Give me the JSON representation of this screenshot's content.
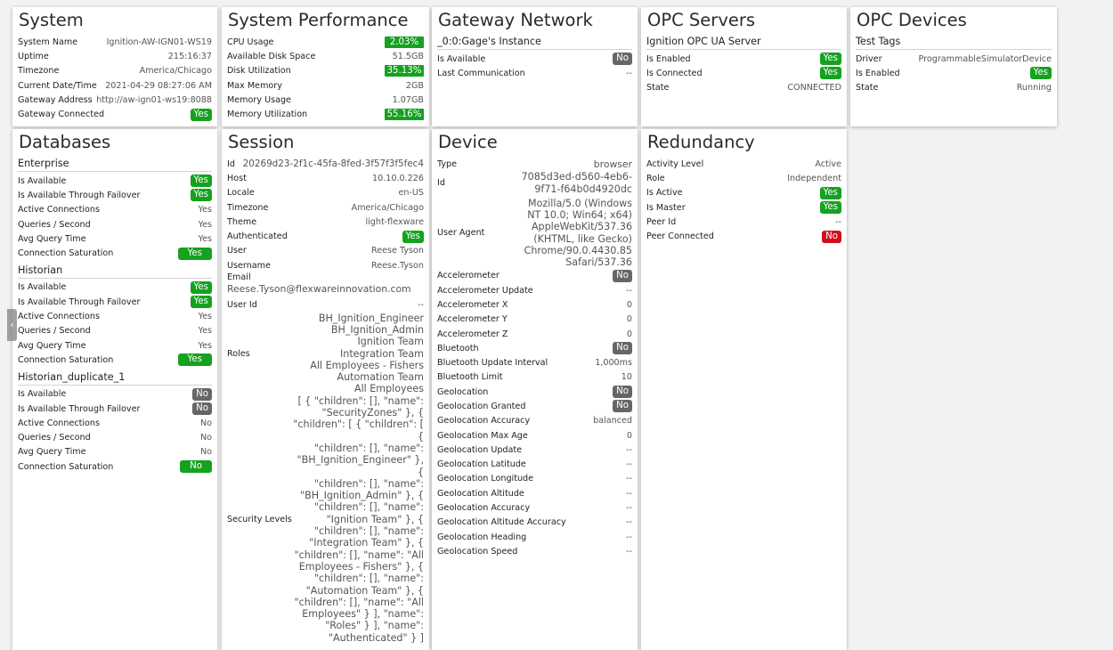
{
  "system": {
    "title": "System",
    "rows": [
      {
        "label": "System Name",
        "value": "Ignition-AW-IGN01-WS19"
      },
      {
        "label": "Uptime",
        "value": "215:16:37"
      },
      {
        "label": "Timezone",
        "value": "America/Chicago"
      },
      {
        "label": "Current Date/Time",
        "value": "2021-04-29 08:27:06 AM"
      },
      {
        "label": "Gateway Address",
        "value": "http://aw-ign01-ws19:8088"
      },
      {
        "label": "Gateway Connected",
        "value": "Yes"
      }
    ]
  },
  "performance": {
    "title": "System Performance",
    "rows": [
      {
        "label": "CPU Usage",
        "value": "2.03%"
      },
      {
        "label": "Available Disk Space",
        "value": "51.5GB"
      },
      {
        "label": "Disk Utilization",
        "value": "35.13%"
      },
      {
        "label": "Max Memory",
        "value": "2GB"
      },
      {
        "label": "Memory Usage",
        "value": "1.07GB"
      },
      {
        "label": "Memory Utilization",
        "value": "55.16%"
      }
    ]
  },
  "gateway_network": {
    "title": "Gateway Network",
    "instance": "_0:0:Gage's Instance",
    "rows": [
      {
        "label": "Is Available",
        "value": "No"
      },
      {
        "label": "Last Communication",
        "value": "--"
      }
    ]
  },
  "opc_servers": {
    "title": "OPC Servers",
    "server": "Ignition OPC UA Server",
    "rows": [
      {
        "label": "Is Enabled",
        "value": "Yes"
      },
      {
        "label": "Is Connected",
        "value": "Yes"
      },
      {
        "label": "State",
        "value": "CONNECTED"
      }
    ]
  },
  "opc_devices": {
    "title": "OPC Devices",
    "device": "Test Tags",
    "rows": [
      {
        "label": "Driver",
        "value": "ProgrammableSimulatorDevice"
      },
      {
        "label": "Is Enabled",
        "value": "Yes"
      },
      {
        "label": "State",
        "value": "Running"
      }
    ]
  },
  "databases": {
    "title": "Databases",
    "groups": [
      {
        "name": "Enterprise",
        "rows": [
          {
            "label": "Is Available",
            "value": "Yes"
          },
          {
            "label": "Is Available Through Failover",
            "value": "Yes"
          },
          {
            "label": "Active Connections",
            "value": "Yes"
          },
          {
            "label": "Queries / Second",
            "value": "Yes"
          },
          {
            "label": "Avg Query Time",
            "value": "Yes"
          },
          {
            "label": "Connection Saturation",
            "value": "Yes"
          }
        ]
      },
      {
        "name": "Historian",
        "rows": [
          {
            "label": "Is Available",
            "value": "Yes"
          },
          {
            "label": "Is Available Through Failover",
            "value": "Yes"
          },
          {
            "label": "Active Connections",
            "value": "Yes"
          },
          {
            "label": "Queries / Second",
            "value": "Yes"
          },
          {
            "label": "Avg Query Time",
            "value": "Yes"
          },
          {
            "label": "Connection Saturation",
            "value": "Yes"
          }
        ]
      },
      {
        "name": "Historian_duplicate_1",
        "rows": [
          {
            "label": "Is Available",
            "value": "No"
          },
          {
            "label": "Is Available Through Failover",
            "value": "No"
          },
          {
            "label": "Active Connections",
            "value": "No"
          },
          {
            "label": "Queries / Second",
            "value": "No"
          },
          {
            "label": "Avg Query Time",
            "value": "No"
          },
          {
            "label": "Connection Saturation",
            "value": "No"
          }
        ]
      }
    ]
  },
  "session": {
    "title": "Session",
    "id_label": "Id",
    "id_value": "20269d23-2f1c-45fa-8fed-3f57f3f5fec4",
    "rows": [
      {
        "label": "Host",
        "value": "10.10.0.226"
      },
      {
        "label": "Locale",
        "value": "en-US"
      },
      {
        "label": "Timezone",
        "value": "America/Chicago"
      },
      {
        "label": "Theme",
        "value": "light-flexware"
      },
      {
        "label": "Authenticated",
        "value": "Yes"
      },
      {
        "label": "User",
        "value": "Reese Tyson"
      },
      {
        "label": "Username",
        "value": "Reese.Tyson"
      }
    ],
    "email_label": "Email",
    "email_value": "Reese.Tyson@flexwareinnovation.com",
    "userid_label": "User Id",
    "userid_value": "--",
    "roles_label": "Roles",
    "roles": [
      "BH_Ignition_Engineer",
      "BH_Ignition_Admin",
      "Ignition Team",
      "Integration Team",
      "All Employees - Fishers",
      "Automation Team",
      "All Employees"
    ],
    "security_label": "Security Levels",
    "security_lines": [
      "[ { \"children\": [], \"name\":",
      "\"SecurityZones\" }, {",
      "\"children\": [ { \"children\": [ {",
      "\"children\": [], \"name\":",
      "\"BH_Ignition_Engineer\" }, {",
      "\"children\": [], \"name\":",
      "\"BH_Ignition_Admin\" }, {",
      "\"children\": [], \"name\":",
      "\"Ignition Team\" }, {",
      "\"children\": [], \"name\":",
      "\"Integration Team\" }, {",
      "\"children\": [], \"name\": \"All",
      "Employees - Fishers\" }, {",
      "\"children\": [], \"name\":",
      "\"Automation Team\" }, {",
      "\"children\": [], \"name\": \"All",
      "Employees\" } ], \"name\":",
      "\"Roles\" } ], \"name\":",
      "\"Authenticated\" } ]"
    ]
  },
  "device": {
    "title": "Device",
    "type_label": "Type",
    "type_value": "browser",
    "id_label": "Id",
    "id_lines": [
      "7085d3ed-d560-4eb6-",
      "9f71-f64b0d4920dc"
    ],
    "ua_label": "User Agent",
    "ua_lines": [
      "Mozilla/5.0 (Windows",
      "NT 10.0; Win64; x64)",
      "AppleWebKit/537.36",
      "(KHTML, like Gecko)",
      "Chrome/90.0.4430.85",
      "Safari/537.36"
    ],
    "rows": [
      {
        "label": "Accelerometer",
        "value": "No"
      },
      {
        "label": "Accelerometer Update",
        "value": "--"
      },
      {
        "label": "Accelerometer X",
        "value": "0"
      },
      {
        "label": "Accelerometer Y",
        "value": "0"
      },
      {
        "label": "Accelerometer Z",
        "value": "0"
      },
      {
        "label": "Bluetooth",
        "value": "No"
      },
      {
        "label": "Bluetooth Update Interval",
        "value": "1,000ms"
      },
      {
        "label": "Bluetooth Limit",
        "value": "10"
      },
      {
        "label": "Geolocation",
        "value": "No"
      },
      {
        "label": "Geolocation Granted",
        "value": "No"
      },
      {
        "label": "Geolocation Accuracy",
        "value": "balanced"
      },
      {
        "label": "Geolocation Max Age",
        "value": "0"
      },
      {
        "label": "Geolocation Update",
        "value": "--"
      },
      {
        "label": "Geolocation Latitude",
        "value": "--"
      },
      {
        "label": "Geolocation Longitude",
        "value": "--"
      },
      {
        "label": "Geolocation Altitude",
        "value": "--"
      },
      {
        "label": "Geolocation Accuracy",
        "value": "--"
      },
      {
        "label": "Geolocation Altitude Accuracy",
        "value": "--"
      },
      {
        "label": "Geolocation Heading",
        "value": "--"
      },
      {
        "label": "Geolocation Speed",
        "value": "--"
      }
    ]
  },
  "redundancy": {
    "title": "Redundancy",
    "rows": [
      {
        "label": "Activity Level",
        "value": "Active"
      },
      {
        "label": "Role",
        "value": "Independent"
      },
      {
        "label": "Is Active",
        "value": "Yes"
      },
      {
        "label": "Is Master",
        "value": "Yes"
      },
      {
        "label": "Peer Id",
        "value": "--"
      },
      {
        "label": "Peer Connected",
        "value": "No"
      }
    ]
  },
  "icons": {
    "collapse_handle": "chevron-left-icon"
  },
  "colors": {
    "yes": "#14a21f",
    "no": "#666666",
    "error": "#d0101b"
  }
}
